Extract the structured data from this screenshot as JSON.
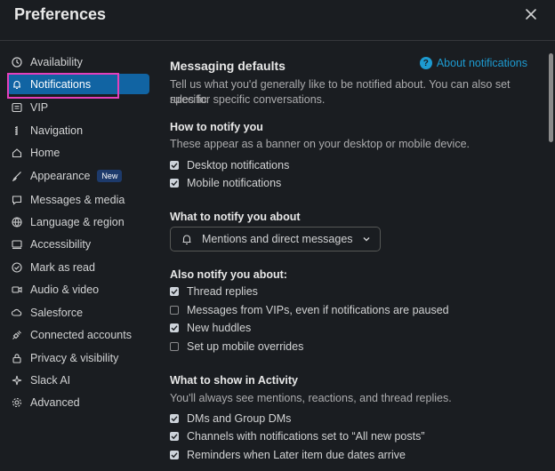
{
  "header": {
    "title": "Preferences"
  },
  "sidebar": {
    "items": [
      {
        "label": "Availability",
        "icon": "clock-icon"
      },
      {
        "label": "Notifications",
        "icon": "bell-icon"
      },
      {
        "label": "VIP",
        "icon": "vip-icon"
      },
      {
        "label": "Navigation",
        "icon": "navigation-icon"
      },
      {
        "label": "Home",
        "icon": "home-icon"
      },
      {
        "label": "Appearance",
        "icon": "brush-icon",
        "badge": "New"
      },
      {
        "label": "Messages & media",
        "icon": "message-icon"
      },
      {
        "label": "Language & region",
        "icon": "globe-icon"
      },
      {
        "label": "Accessibility",
        "icon": "keyboard-icon"
      },
      {
        "label": "Mark as read",
        "icon": "check-circle-icon"
      },
      {
        "label": "Audio & video",
        "icon": "video-icon"
      },
      {
        "label": "Salesforce",
        "icon": "cloud-icon"
      },
      {
        "label": "Connected accounts",
        "icon": "plug-icon"
      },
      {
        "label": "Privacy & visibility",
        "icon": "lock-icon"
      },
      {
        "label": "Slack AI",
        "icon": "sparkle-icon"
      },
      {
        "label": "Advanced",
        "icon": "gear-icon"
      }
    ]
  },
  "main": {
    "heading": "Messaging defaults",
    "about_link": "About notifications",
    "intro_line1": "Tell us what you'd generally like to be notified about. You can also set specific",
    "intro_line2": "rules for specific conversations.",
    "how": {
      "title": "How to notify you",
      "desc": "These appear as a banner on your desktop or mobile device.",
      "options": [
        {
          "label": "Desktop notifications",
          "checked": true
        },
        {
          "label": "Mobile notifications",
          "checked": true
        }
      ]
    },
    "what": {
      "title": "What to notify you about",
      "selected": "Mentions and direct messages"
    },
    "also": {
      "title": "Also notify you about:",
      "options": [
        {
          "label": "Thread replies",
          "checked": true
        },
        {
          "label": "Messages from VIPs, even if notifications are paused",
          "checked": false
        },
        {
          "label": "New huddles",
          "checked": true
        },
        {
          "label": "Set up mobile overrides",
          "checked": false
        }
      ]
    },
    "activity": {
      "title": "What to show in Activity",
      "desc": "You'll always see mentions, reactions, and thread replies.",
      "options": [
        {
          "label": "DMs and Group DMs",
          "checked": true
        },
        {
          "label": "Channels with notifications set to “All new posts”",
          "checked": true
        },
        {
          "label": "Reminders when Later item due dates arrive",
          "checked": true
        }
      ]
    }
  },
  "colors": {
    "background": "#1a1d21",
    "active_item": "#1164a3",
    "link": "#1d9bd1",
    "highlight_border": "#e43fbb"
  }
}
